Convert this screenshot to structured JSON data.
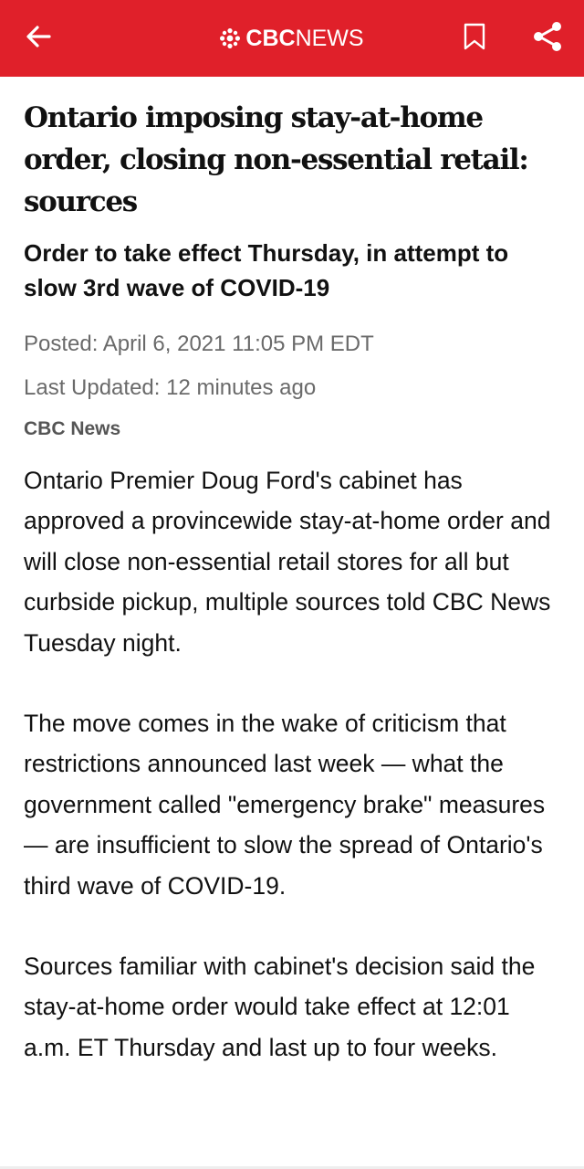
{
  "app_bar": {
    "background": "#e0202a",
    "brand_bold": "CBC",
    "brand_light": "NEWS",
    "icons": {
      "back": "arrow-left-icon",
      "logo": "cbc-gem-icon",
      "bookmark": "bookmark-icon",
      "share": "share-icon"
    }
  },
  "article": {
    "headline": "Ontario imposing stay-at-home order, closing non-essential retail: sources",
    "deck": "Order to take effect Thursday, in attempt to slow 3rd wave of COVID-19",
    "posted": "Posted: April 6, 2021 11:05 PM EDT",
    "updated": "Last Updated: 12 minutes ago",
    "byline": "CBC News",
    "paragraphs": [
      "Ontario Premier Doug Ford's cabinet has approved a provincewide stay-at-home order and will close non-essential retail stores for all but curbside pickup, multiple sources told CBC News Tuesday night.",
      "The move comes in the wake of criticism that restrictions announced last week — what the government called \"emergency brake\" measures — are insufficient to slow the spread of Ontario's third wave of COVID-19.",
      "Sources familiar with cabinet's decision said the stay-at-home order would take effect at 12:01 a.m. ET Thursday and last up to four weeks."
    ]
  }
}
